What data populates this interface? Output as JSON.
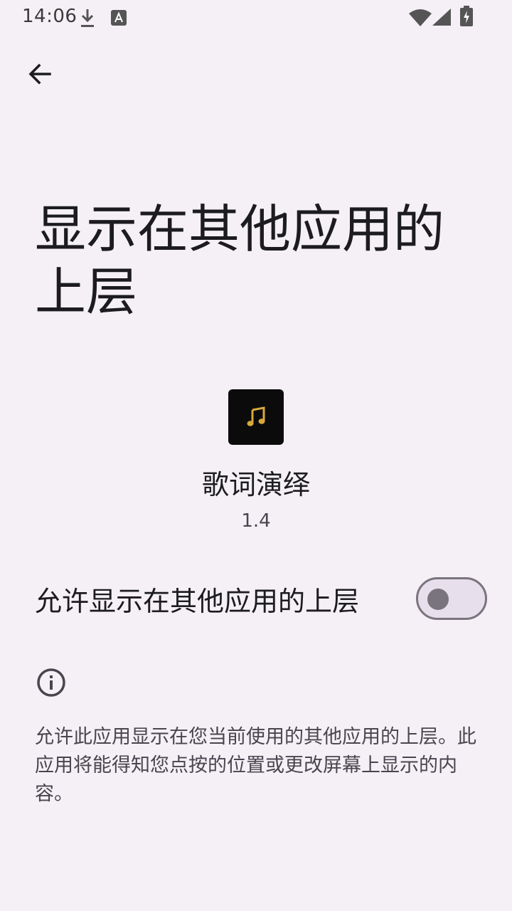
{
  "status_bar": {
    "time": "14:06",
    "icons": [
      "download-icon",
      "a-badge-icon",
      "wifi-icon",
      "signal-icon",
      "battery-charging-icon"
    ]
  },
  "header": {
    "back_icon": "arrow-back-icon",
    "title": "显示在其他应用的上层"
  },
  "app": {
    "icon": "music-note-icon",
    "name": "歌词演绎",
    "version": "1.4"
  },
  "permission": {
    "label": "允许显示在其他应用的上层",
    "enabled": false
  },
  "info": {
    "icon": "info-icon",
    "description": "允许此应用显示在您当前使用的其他应用的上层。此应用将能得知您点按的位置或更改屏幕上显示的内容。"
  },
  "colors": {
    "background": "#f4f0f5",
    "text_primary": "#1c1b1f",
    "text_secondary": "#49454f",
    "switch_outline": "#79747e",
    "app_icon_bg": "#0b0b0b",
    "app_icon_note": "#d7a93c"
  }
}
